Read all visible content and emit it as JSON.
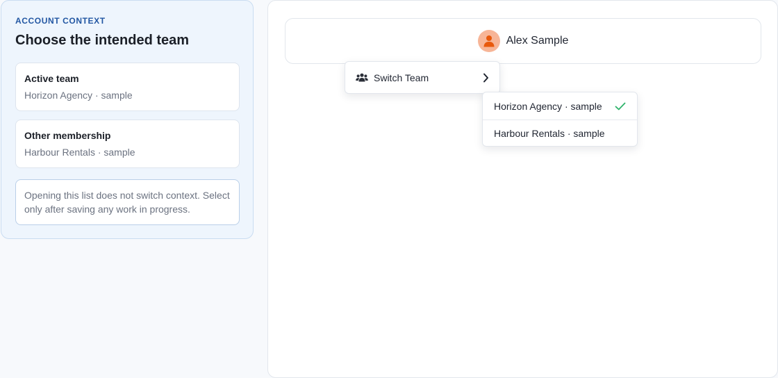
{
  "context": {
    "eyebrow": "ACCOUNT CONTEXT",
    "title": "Choose the intended team",
    "active_card": {
      "title": "Active team",
      "value": "Horizon Agency · sample"
    },
    "other_card": {
      "title": "Other membership",
      "value": "Harbour Rentals · sample"
    },
    "note": "Opening this list does not switch context. Select only after saving any work in progress."
  },
  "user": {
    "name": "Alex Sample",
    "avatar_icon": "user-icon"
  },
  "menu": {
    "label": "Switch Team",
    "icon": "users-icon",
    "chevron_icon": "chevron-right-icon"
  },
  "teams": [
    {
      "label": "Horizon Agency · sample",
      "selected": true
    },
    {
      "label": "Harbour Rentals · sample",
      "selected": false
    }
  ],
  "colors": {
    "accent": "#2357a3",
    "avatar_bg": "#f7b597",
    "avatar_fg": "#e8590c",
    "check": "#2fb36b"
  }
}
